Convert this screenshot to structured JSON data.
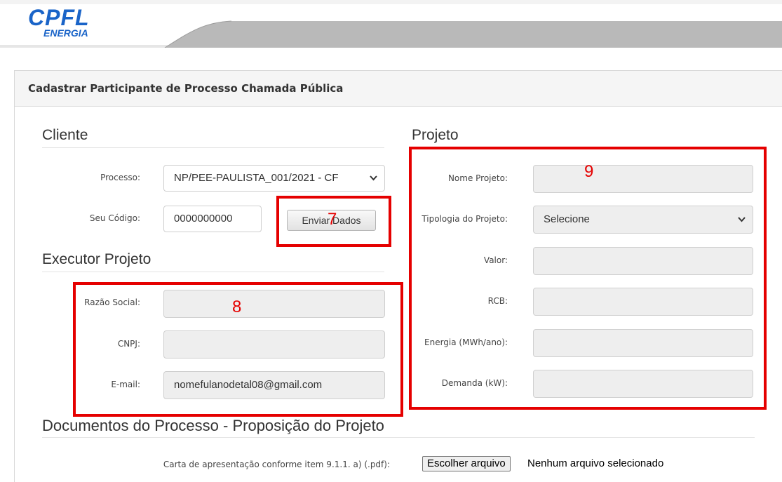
{
  "header": {
    "logo_main": "CPFL",
    "logo_sub": "ENERGIA"
  },
  "panel": {
    "title": "Cadastrar Participante de Processo Chamada Pública"
  },
  "cliente": {
    "title": "Cliente",
    "processo_label": "Processo:",
    "processo_value": "NP/PEE-PAULISTA_001/2021 - CF",
    "codigo_label": "Seu Código:",
    "codigo_value": "0000000000",
    "enviar_label": "Enviar Dados"
  },
  "executor": {
    "title": "Executor Projeto",
    "razao_label": "Razão Social:",
    "razao_value": "",
    "cnpj_label": "CNPJ:",
    "cnpj_value": "",
    "email_label": "E-mail:",
    "email_value": "nomefulanodetal08@gmail.com"
  },
  "projeto": {
    "title": "Projeto",
    "nome_label": "Nome Projeto:",
    "nome_value": "",
    "tipologia_label": "Tipologia do Projeto:",
    "tipologia_value": "Selecione",
    "valor_label": "Valor:",
    "valor_value": "",
    "rcb_label": "RCB:",
    "rcb_value": "",
    "energia_label": "Energia (MWh/ano):",
    "energia_value": "",
    "demanda_label": "Demanda (kW):",
    "demanda_value": ""
  },
  "documentos": {
    "title": "Documentos do Processo - Proposição do Projeto",
    "carta_label": "Carta de apresentação conforme item 9.1.1. a) (.pdf):",
    "file_button": "Escolher arquivo",
    "file_status": "Nenhum arquivo selecionado"
  },
  "annotations": {
    "box7": "7",
    "box8": "8",
    "box9": "9",
    "color": "#e50000"
  },
  "icons": {
    "select_arrow": "chevron-down-icon"
  }
}
